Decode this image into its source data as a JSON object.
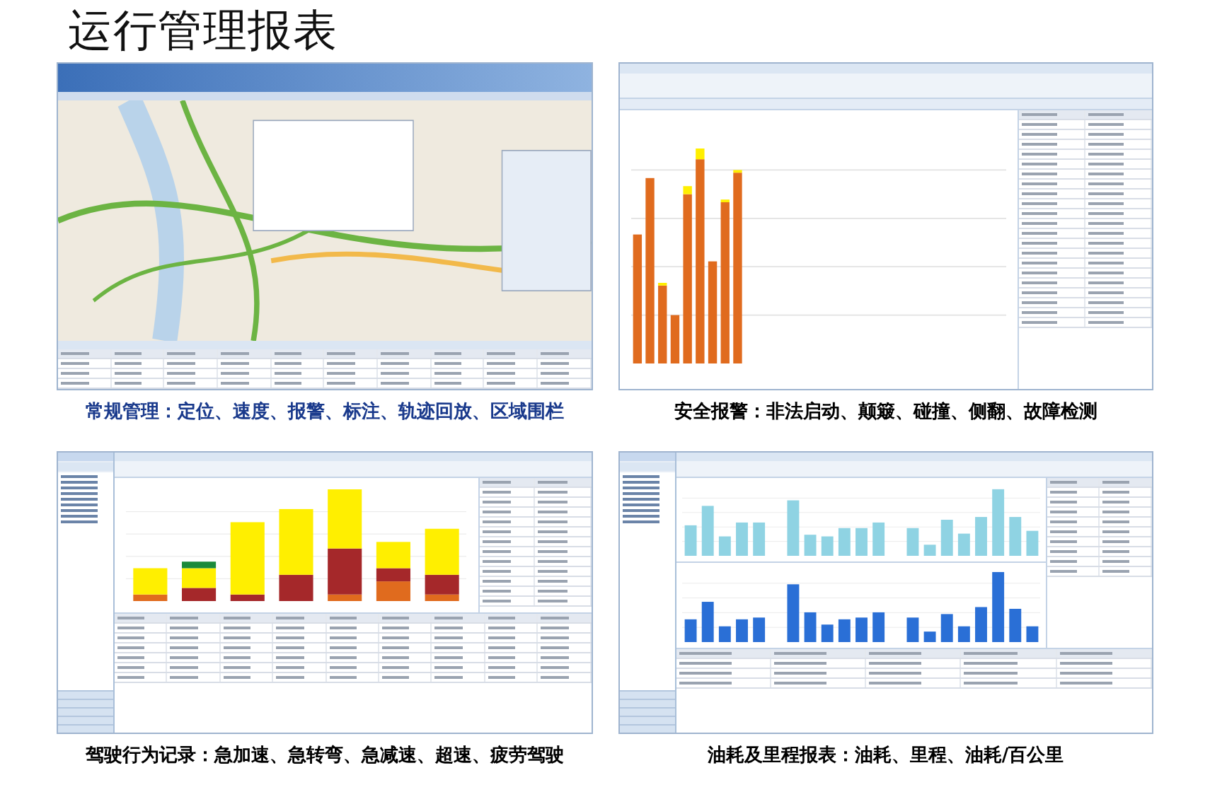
{
  "title": "运行管理报表",
  "panels": [
    {
      "kind": "map",
      "caption": "常规管理：定位、速度、报警、标注、轨迹回放、区域围栏",
      "color": "#1a3a8c"
    },
    {
      "kind": "alarm",
      "caption": "安全报警：非法启动、颠簸、碰撞、侧翻、故障检测",
      "color": "#000000"
    },
    {
      "kind": "behavior",
      "caption": "驾驶行为记录：急加速、急转弯、急减速、超速、疲劳驾驶",
      "color": "#000000"
    },
    {
      "kind": "fuel",
      "caption": "油耗及里程报表：油耗、里程、油耗/百公里",
      "color": "#000000"
    }
  ]
}
